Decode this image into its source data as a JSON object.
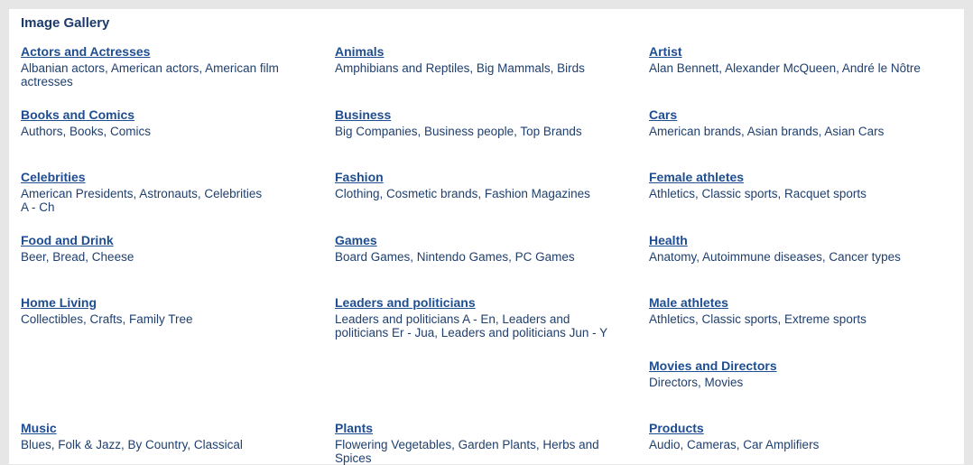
{
  "gallery": {
    "title": "Image Gallery",
    "categories": [
      {
        "name": "Actors and Actresses",
        "items": "Albanian actors, American actors, American film actresses"
      },
      {
        "name": "Animals",
        "items": "Amphibians and Reptiles, Big Mammals, Birds"
      },
      {
        "name": "Artist",
        "items": "Alan Bennett, Alexander McQueen, André le Nôtre"
      },
      {
        "name": "Books and Comics",
        "items": "Authors, Books, Comics"
      },
      {
        "name": "Business",
        "items": "Big Companies, Business people, Top Brands"
      },
      {
        "name": "Cars",
        "items": "American brands, Asian brands, Asian Cars"
      },
      {
        "name": "Celebrities",
        "items": "American Presidents, Astronauts, Celebrities A - Ch"
      },
      {
        "name": "Fashion",
        "items": "Clothing, Cosmetic brands, Fashion Magazines"
      },
      {
        "name": "Female athletes",
        "items": "Athletics, Classic sports, Racquet sports"
      },
      {
        "name": "Food and Drink",
        "items": "Beer, Bread, Cheese"
      },
      {
        "name": "Games",
        "items": "Board Games, Nintendo Games, PC Games"
      },
      {
        "name": "Health",
        "items": "Anatomy, Autoimmune diseases, Cancer types"
      },
      {
        "name": "Home Living",
        "items": "Collectibles, Crafts, Family Tree"
      },
      {
        "name": "Leaders and politicians",
        "items": "Leaders and politicians A - En, Leaders and politicians Er - Jua, Leaders and politicians Jun - Y"
      },
      {
        "name": "Male athletes",
        "items": "Athletics, Classic sports, Extreme sports"
      },
      {
        "name": "Movies and Directors",
        "items": "Directors, Movies"
      },
      {
        "name": "Music",
        "items": "Blues, Folk & Jazz, By Country, Classical"
      },
      {
        "name": "Plants",
        "items": "Flowering Vegetables, Garden Plants, Herbs and Spices"
      },
      {
        "name": "Products",
        "items": "Audio, Cameras, Car Amplifiers"
      }
    ]
  }
}
